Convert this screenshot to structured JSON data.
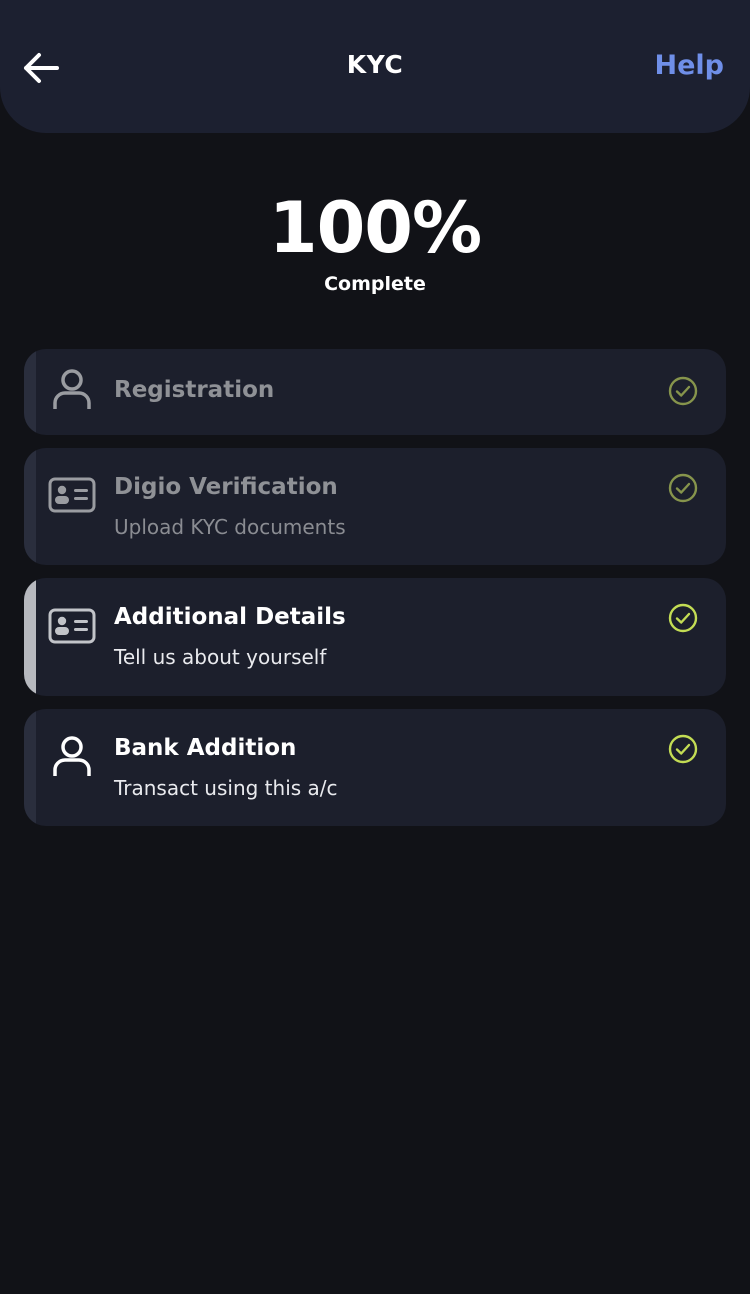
{
  "header": {
    "title": "KYC",
    "help_label": "Help",
    "back_icon": "arrow-left-icon"
  },
  "progress": {
    "value": "100%",
    "label": "Complete"
  },
  "steps": [
    {
      "title": "Registration",
      "subtitle": "",
      "icon": "user-icon",
      "status": "complete",
      "state": "done"
    },
    {
      "title": "Digio Verification",
      "subtitle": "Upload KYC documents",
      "icon": "id-card-icon",
      "status": "complete",
      "state": "done"
    },
    {
      "title": "Additional Details",
      "subtitle": "Tell us about yourself",
      "icon": "id-card-icon",
      "status": "complete",
      "state": "active"
    },
    {
      "title": "Bank Addition",
      "subtitle": "Transact using this a/c",
      "icon": "user-icon",
      "status": "complete",
      "state": "active"
    }
  ],
  "colors": {
    "background": "#111217",
    "header": "#1c2030",
    "card": "#1c1f2c",
    "help_link": "#6f8fe8",
    "check_muted": "#86944c",
    "check_bright": "#c3dc54"
  }
}
